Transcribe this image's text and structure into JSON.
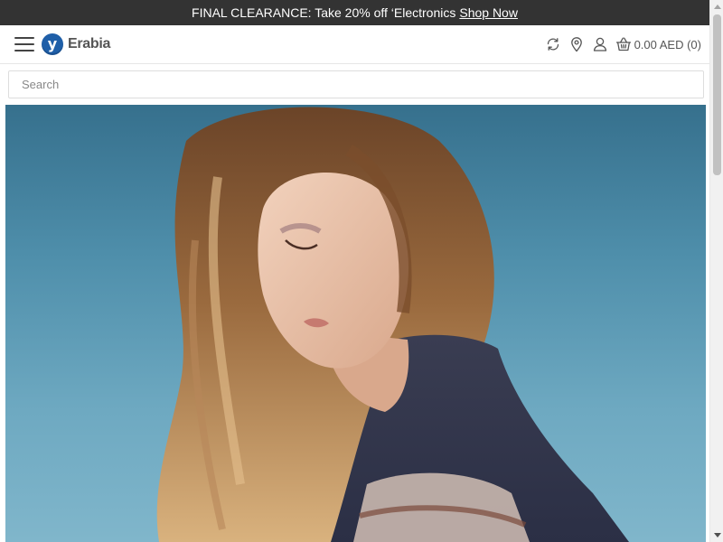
{
  "promo": {
    "text": "FINAL CLEARANCE: Take 20% off ‘Electronics",
    "link": "Shop Now"
  },
  "header": {
    "logo_badge": "y",
    "logo_text": "Erabia",
    "icons": [
      "menu-icon",
      "refresh-icon",
      "location-pin-icon",
      "user-icon",
      "basket-icon"
    ],
    "cart_label": "0.00 AED (0)"
  },
  "search": {
    "placeholder": "Search",
    "value": ""
  },
  "hero": {
    "alt": "Banner image"
  },
  "colors": {
    "promo_bg": "#333333",
    "logo_blue": "#1f5fa8",
    "hero_bg": "#4f8fab"
  }
}
